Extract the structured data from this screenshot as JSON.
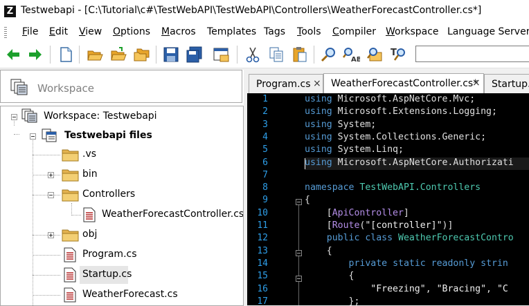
{
  "window": {
    "title": "Testwebapi - [C:\\Tutorial\\c#\\TestWebAPI\\TestWebAPI\\Controllers\\WeatherForecastController.cs*]",
    "app_icon_letter": "Z"
  },
  "menu": {
    "items": [
      {
        "label": "File",
        "accel": "F",
        "rest": "ile"
      },
      {
        "label": "Edit",
        "accel": "E",
        "rest": "dit"
      },
      {
        "label": "View",
        "accel": "V",
        "rest": "iew"
      },
      {
        "label": "Options",
        "accel": "O",
        "rest": "ptions"
      },
      {
        "label": "Macros",
        "accel": "M",
        "rest": "acros"
      },
      {
        "label": "Templates",
        "accel": "",
        "rest": "Templates"
      },
      {
        "label": "Tags",
        "accel": "",
        "rest": "Tags"
      },
      {
        "label": "Tools",
        "accel": "T",
        "rest": "ools"
      },
      {
        "label": "Compiler",
        "accel": "C",
        "rest": "ompiler"
      },
      {
        "label": "Workspace",
        "accel": "W",
        "rest": "orkspace"
      },
      {
        "label": "Language Server",
        "accel": "",
        "rest": "Language Server"
      }
    ]
  },
  "toolbar": {
    "buttons": [
      "back-arrow-icon",
      "forward-arrow-icon",
      "new-document-icon",
      "open-folder-icon",
      "open-folder-alt-icon",
      "open-multiple-folders-icon",
      "save-icon",
      "save-all-icon",
      "window-icon",
      "cut-icon",
      "copy-icon",
      "paste-icon",
      "find-icon",
      "find-replace-icon",
      "find-in-files-icon",
      "find-text-icon"
    ],
    "search_value": ""
  },
  "workspace": {
    "header": "Workspace",
    "tree": [
      {
        "label": "Workspace: Testwebapi",
        "icon": "workspace-icon",
        "bold": false
      },
      {
        "label": "Testwebapi files",
        "icon": "project-icon",
        "bold": true
      },
      {
        "label": ".vs",
        "icon": "folder-icon",
        "bold": false
      },
      {
        "label": "bin",
        "icon": "folder-icon",
        "bold": false
      },
      {
        "label": "Controllers",
        "icon": "folder-icon",
        "bold": false
      },
      {
        "label": "WeatherForecastController.cs",
        "icon": "file-icon",
        "bold": false
      },
      {
        "label": "obj",
        "icon": "folder-icon",
        "bold": false
      },
      {
        "label": "Program.cs",
        "icon": "file-icon",
        "bold": false
      },
      {
        "label": "Startup.cs",
        "icon": "file-icon",
        "bold": false,
        "selected": true
      },
      {
        "label": "WeatherForecast.cs",
        "icon": "file-icon",
        "bold": false
      }
    ]
  },
  "editor": {
    "tabs": [
      {
        "label": "Program.cs",
        "active": false,
        "close": "×"
      },
      {
        "label": "WeatherForecastController.cs*",
        "active": true,
        "close": "×"
      },
      {
        "label": "Startup.cs",
        "active": false,
        "close": ""
      }
    ],
    "line_numbers": [
      "1",
      "2",
      "3",
      "4",
      "5",
      "6",
      "7",
      "8",
      "9",
      "10",
      "11",
      "12",
      "13",
      "14",
      "15",
      "16",
      "17"
    ],
    "colors": {
      "keyword": "#569cd6",
      "type": "#4ec9b0",
      "string": "#f0f0f0",
      "text": "#e0e0e0",
      "attribute": "#b48ee8",
      "linenum": "#2e9ee8"
    },
    "lines": [
      [
        [
          "kw",
          "using"
        ],
        [
          "tx",
          " Microsoft.AspNetCore.Mvc;"
        ]
      ],
      [
        [
          "kw",
          "using"
        ],
        [
          "tx",
          " Microsoft.Extensions.Logging;"
        ]
      ],
      [
        [
          "kw",
          "using"
        ],
        [
          "tx",
          " System;"
        ]
      ],
      [
        [
          "kw",
          "using"
        ],
        [
          "tx",
          " System.Collections.Generic;"
        ]
      ],
      [
        [
          "kw",
          "using"
        ],
        [
          "tx",
          " System.Linq;"
        ]
      ],
      [
        [
          "kw",
          "using"
        ],
        [
          "tx",
          " Microsoft.AspNetCore.Authorizati"
        ]
      ],
      [],
      [
        [
          "kw",
          "namespace"
        ],
        [
          "tx",
          " "
        ],
        [
          "ty",
          "TestWebAPI.Controllers"
        ]
      ],
      [
        [
          "tx",
          "{"
        ]
      ],
      [
        [
          "tx",
          "    ["
        ],
        [
          "at",
          "ApiController"
        ],
        [
          "tx",
          "]"
        ]
      ],
      [
        [
          "tx",
          "    ["
        ],
        [
          "at",
          "Route"
        ],
        [
          "tx",
          "("
        ],
        [
          "st",
          "\"[controller]\""
        ],
        [
          "tx",
          ")]"
        ]
      ],
      [
        [
          "tx",
          "    "
        ],
        [
          "kw",
          "public"
        ],
        [
          "tx",
          " "
        ],
        [
          "kw",
          "class"
        ],
        [
          "tx",
          " "
        ],
        [
          "ty",
          "WeatherForecastContro"
        ]
      ],
      [
        [
          "tx",
          "    {"
        ]
      ],
      [
        [
          "tx",
          "        "
        ],
        [
          "kw",
          "private"
        ],
        [
          "tx",
          " "
        ],
        [
          "kw",
          "static"
        ],
        [
          "tx",
          " "
        ],
        [
          "kw",
          "readonly"
        ],
        [
          "tx",
          " "
        ],
        [
          "kw",
          "strin"
        ]
      ],
      [
        [
          "tx",
          "        {"
        ]
      ],
      [
        [
          "tx",
          "            "
        ],
        [
          "st",
          "\"Freezing\""
        ],
        [
          "tx",
          ", "
        ],
        [
          "st",
          "\"Bracing\""
        ],
        [
          "tx",
          ", "
        ],
        [
          "st",
          "\"C"
        ]
      ],
      [
        [
          "tx",
          "        };"
        ]
      ]
    ]
  }
}
